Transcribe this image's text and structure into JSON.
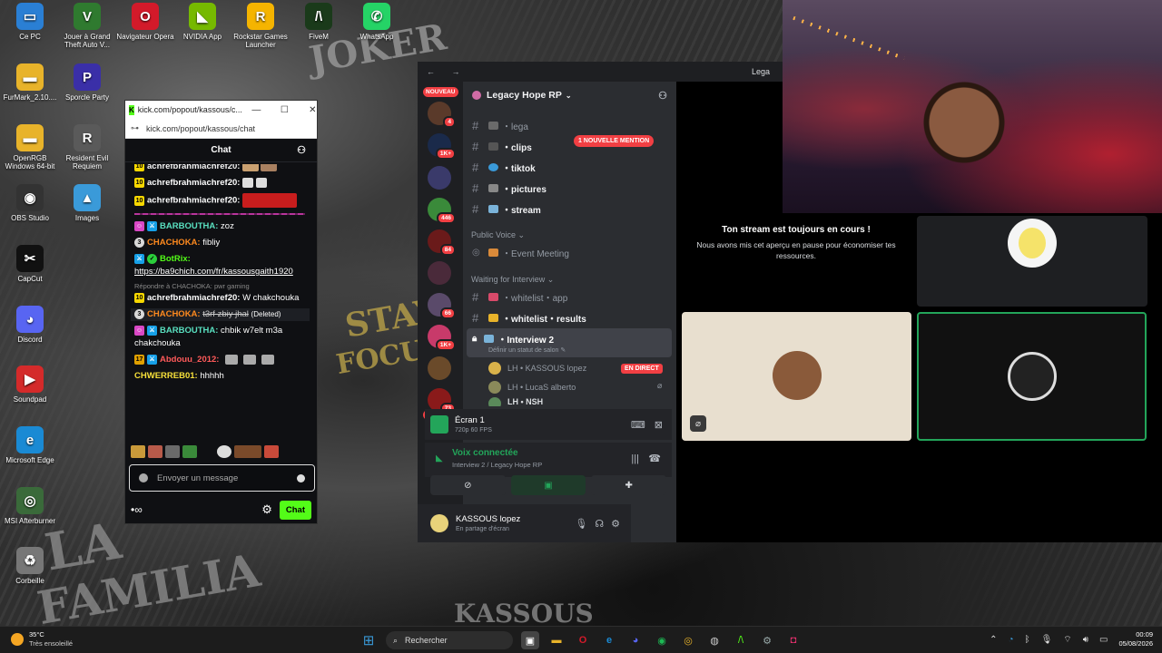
{
  "desktop": {
    "icons": [
      {
        "label": "Ce PC",
        "glyph": "▭",
        "color": "#2a7fd4"
      },
      {
        "label": "Jouer à Grand Theft Auto V...",
        "glyph": "V",
        "color": "#2f7a2f"
      },
      {
        "label": "Navigateur Opera",
        "glyph": "O",
        "color": "#d31a2a"
      },
      {
        "label": "NVIDIA App",
        "glyph": "◣",
        "color": "#76b900"
      },
      {
        "label": "Rockstar Games Launcher",
        "glyph": "R",
        "color": "#f5b400"
      },
      {
        "label": "FiveM",
        "glyph": "/\\",
        "color": "#1a3a1a"
      },
      {
        "label": "WhatsApp",
        "glyph": "✆",
        "color": "#25d366"
      },
      {
        "label": "FurMark_2.10....",
        "glyph": "▬",
        "color": "#e8b32a"
      },
      {
        "label": "Sporcle Party",
        "glyph": "P",
        "color": "#3a2fa8"
      },
      {
        "label": "OpenRGB Windows 64-bit",
        "glyph": "▬",
        "color": "#e8b32a"
      },
      {
        "label": "Resident Evil Requiem",
        "glyph": "R",
        "color": "#5a5a5a"
      },
      {
        "label": "OBS Studio",
        "glyph": "◉",
        "color": "#333333"
      },
      {
        "label": "Images",
        "glyph": "▲",
        "color": "#3a9ad9"
      },
      {
        "label": "CapCut",
        "glyph": "✂",
        "color": "#111111"
      },
      {
        "label": "Discord",
        "glyph": "◕",
        "color": "#5865f2"
      },
      {
        "label": "Soundpad",
        "glyph": "▶",
        "color": "#d42a2a"
      },
      {
        "label": "Microsoft Edge",
        "glyph": "e",
        "color": "#1a8ad4"
      },
      {
        "label": "MSI Afterburner",
        "glyph": "◎",
        "color": "#3a6a3a"
      },
      {
        "label": "Corbeille",
        "glyph": "♻",
        "color": "#777777"
      }
    ],
    "wall_text": [
      "LA",
      "FAMILIA",
      "STAY",
      "FOCUS",
      "JOKER",
      "KASSOUS"
    ]
  },
  "kick": {
    "window_title": "kick.com/popout/kassous/c...",
    "url": "kick.com/popout/kassous/chat",
    "header": "Chat",
    "messages": [
      {
        "badge": "10",
        "name": "achrefbrahmiachref20:",
        "text": "",
        "color": "#f5f5f5"
      },
      {
        "badge": "10",
        "name": "achrefbrahmiachref20:",
        "text": "",
        "color": "#f5f5f5"
      },
      {
        "badge": "10",
        "name": "achrefbrahmiachref20:",
        "text": "",
        "color": "#f5f5f5"
      },
      {
        "badge": "",
        "name": "BARBOUTHA:",
        "text": "zoz",
        "color": "#59e0c0"
      },
      {
        "badge": "3",
        "name": "CHACHOKA:",
        "text": "fibliy",
        "color": "#ff8a1e"
      },
      {
        "badge": "",
        "name": "BotRix:",
        "text": "",
        "color": "#53fc18"
      },
      {
        "badge": "",
        "name": "",
        "text": "https://ba9chich.com/fr/kassousgaith1920",
        "color": "#ffffff"
      },
      {
        "badge": "10",
        "name": "achrefbrahmiachref20:",
        "text": "W chakchouka",
        "color": "#f5f5f5"
      },
      {
        "badge": "3",
        "name": "CHACHOKA:",
        "text": "t3rf zbiy jhal",
        "color": "#ff8a1e"
      },
      {
        "badge": "",
        "name": "BARBOUTHA:",
        "text": "chbik w7elt m3a chakchouka",
        "color": "#59e0c0"
      },
      {
        "badge": "17",
        "name": "Abdouu_2012:",
        "text": "",
        "color": "#ff5a5a"
      },
      {
        "badge": "",
        "name": "CHWERREB01:",
        "text": "hhhhh",
        "color": "#f7e03a"
      }
    ],
    "reply_text": "Répondre à CHACHOKA: pwr gaming",
    "deleted_label": "(Deleted)",
    "placeholder": "Envoyer un message",
    "chat_button": "Chat",
    "bottom_glyph": "∞"
  },
  "discord": {
    "title": "Lega",
    "server_name": "Legacy Hope RP",
    "mention_pill": "1 NOUVELLE MENTION",
    "nouveau": "NOUVEAU",
    "server_badges": [
      "111",
      "4",
      "1K+",
      "446",
      "84",
      "66",
      "1K+",
      "73",
      "3"
    ],
    "channels": [
      {
        "name": "・lega",
        "muted": true
      },
      {
        "name": "・clips",
        "muted": false
      },
      {
        "name": "・tiktok",
        "muted": false
      },
      {
        "name": "・pictures",
        "muted": false
      },
      {
        "name": "・stream",
        "muted": false
      }
    ],
    "cat_public_voice": "Public Voice",
    "event_channel": "・Event Meeting",
    "cat_waiting": "Waiting for Interview",
    "whitelist_app": "・whitelist・app",
    "whitelist_results": "・whitelist・results",
    "interview": "・Interview 2",
    "set_status": "Définir un statut de salon",
    "voice_users": [
      {
        "name": "LH • KASSOUS lopez",
        "live": "EN DIRECT"
      },
      {
        "name": "LH • LucaS alberto",
        "live": ""
      },
      {
        "name": "LH • NSH",
        "live": ""
      }
    ],
    "screen_title": "Écran 1",
    "screen_sub": "720p 60 FPS",
    "voice_connected": "Voix connectée",
    "voice_location": "Interview 2 / Legacy Hope RP",
    "user_name": "KASSOUS lopez",
    "user_status": "En partage d'écran",
    "paused_title": "Ton stream est toujours en cours !",
    "paused_text": "Nous avons mis cet aperçu en pause pour économiser tes ressources."
  },
  "taskbar": {
    "temp": "35°C",
    "weather": "Très ensoleillé",
    "search": "Rechercher",
    "time": "00:09",
    "date": "05/08/2026"
  }
}
